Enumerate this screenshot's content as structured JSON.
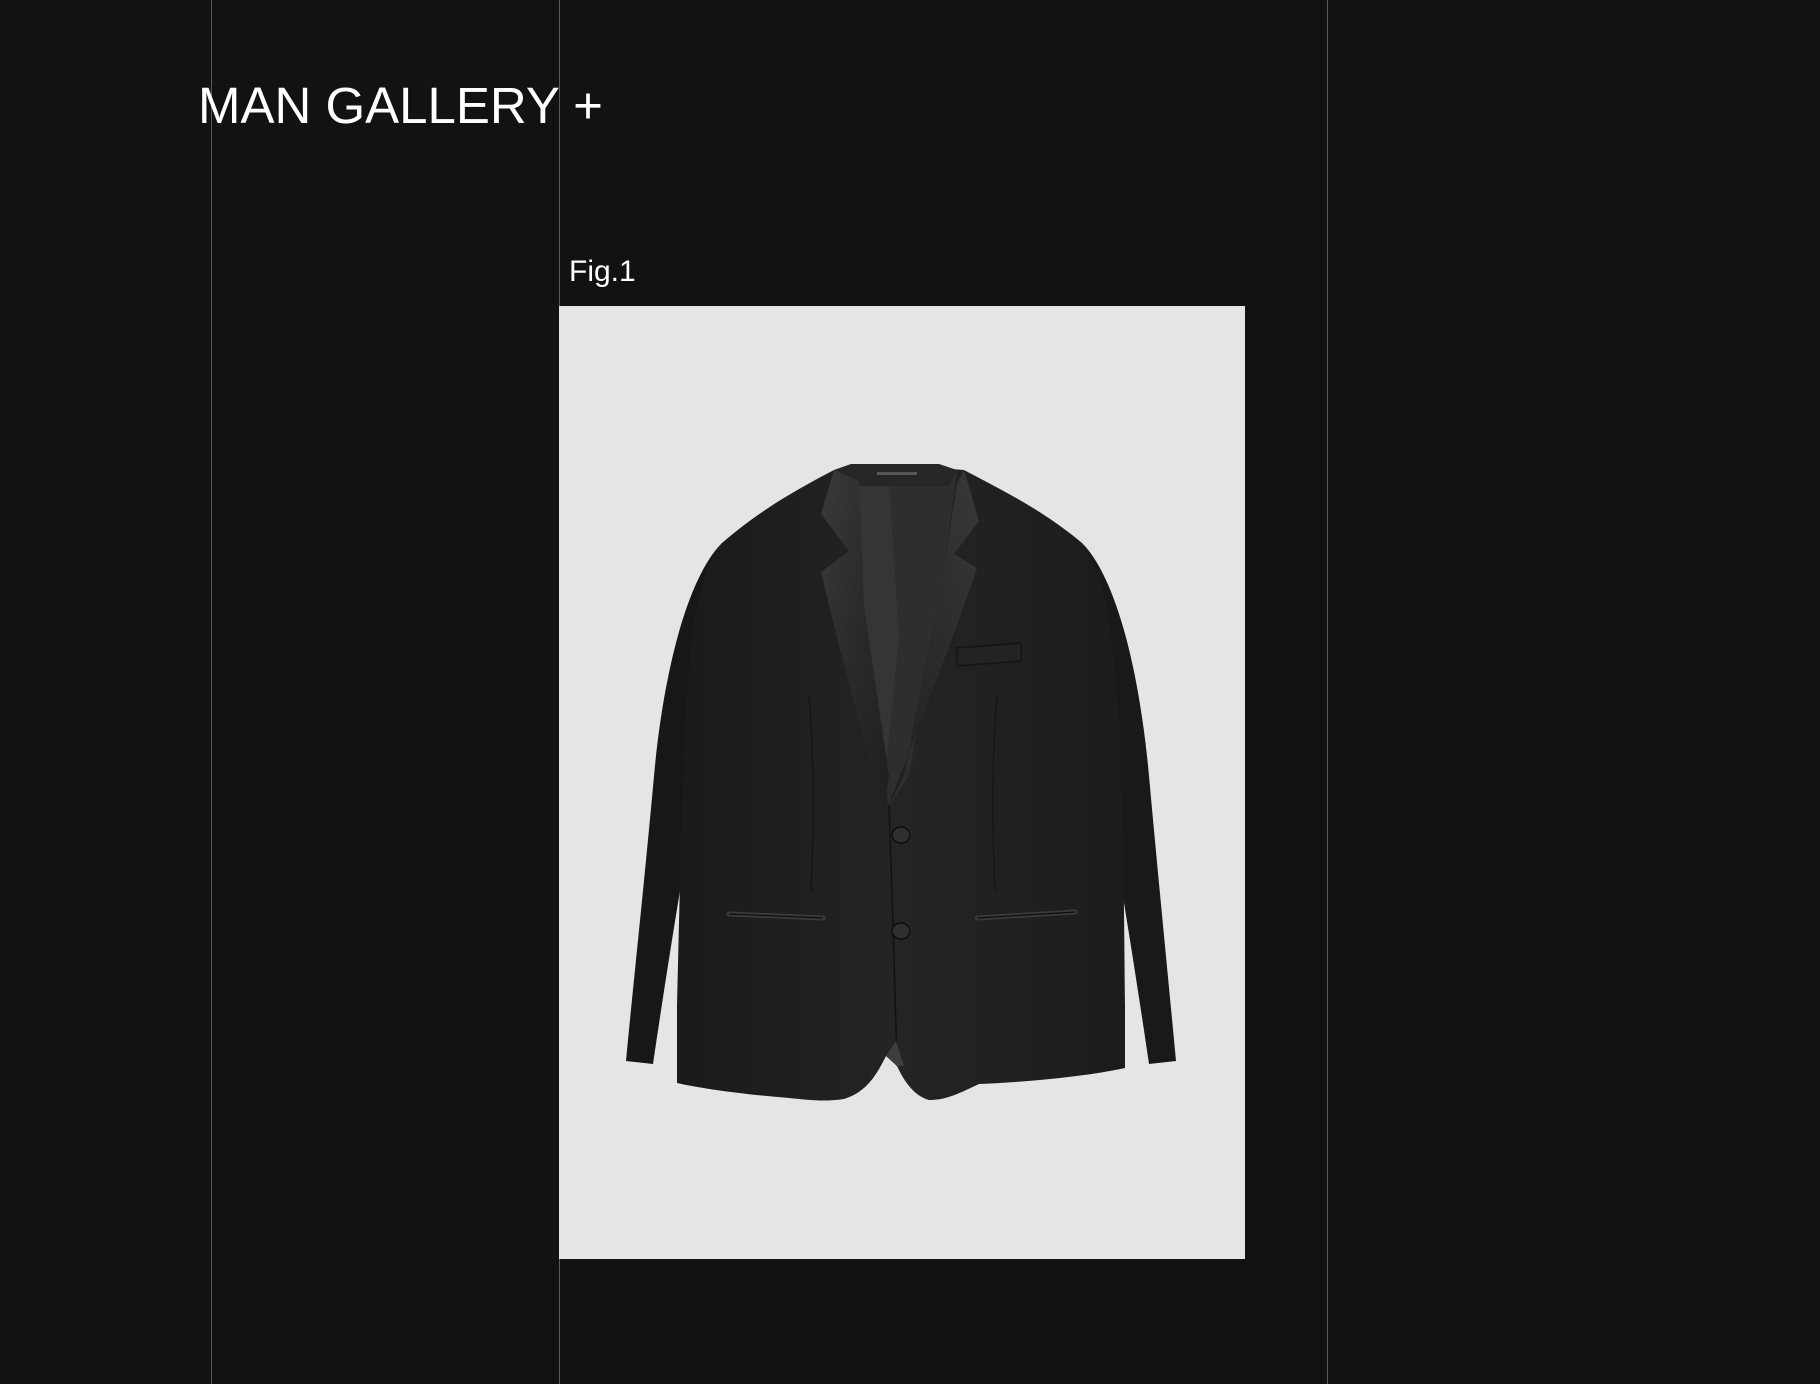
{
  "header": {
    "title": "MAN GALLERY +"
  },
  "figure": {
    "label": "Fig.1",
    "subject": "black single-breasted tuxedo jacket with satin lapels"
  },
  "colors": {
    "background": "#121212",
    "divider": "#5a5a5a",
    "figure_background": "#e5e5e5",
    "text": "#ffffff"
  },
  "icons": {
    "title_action": "plus-icon"
  }
}
